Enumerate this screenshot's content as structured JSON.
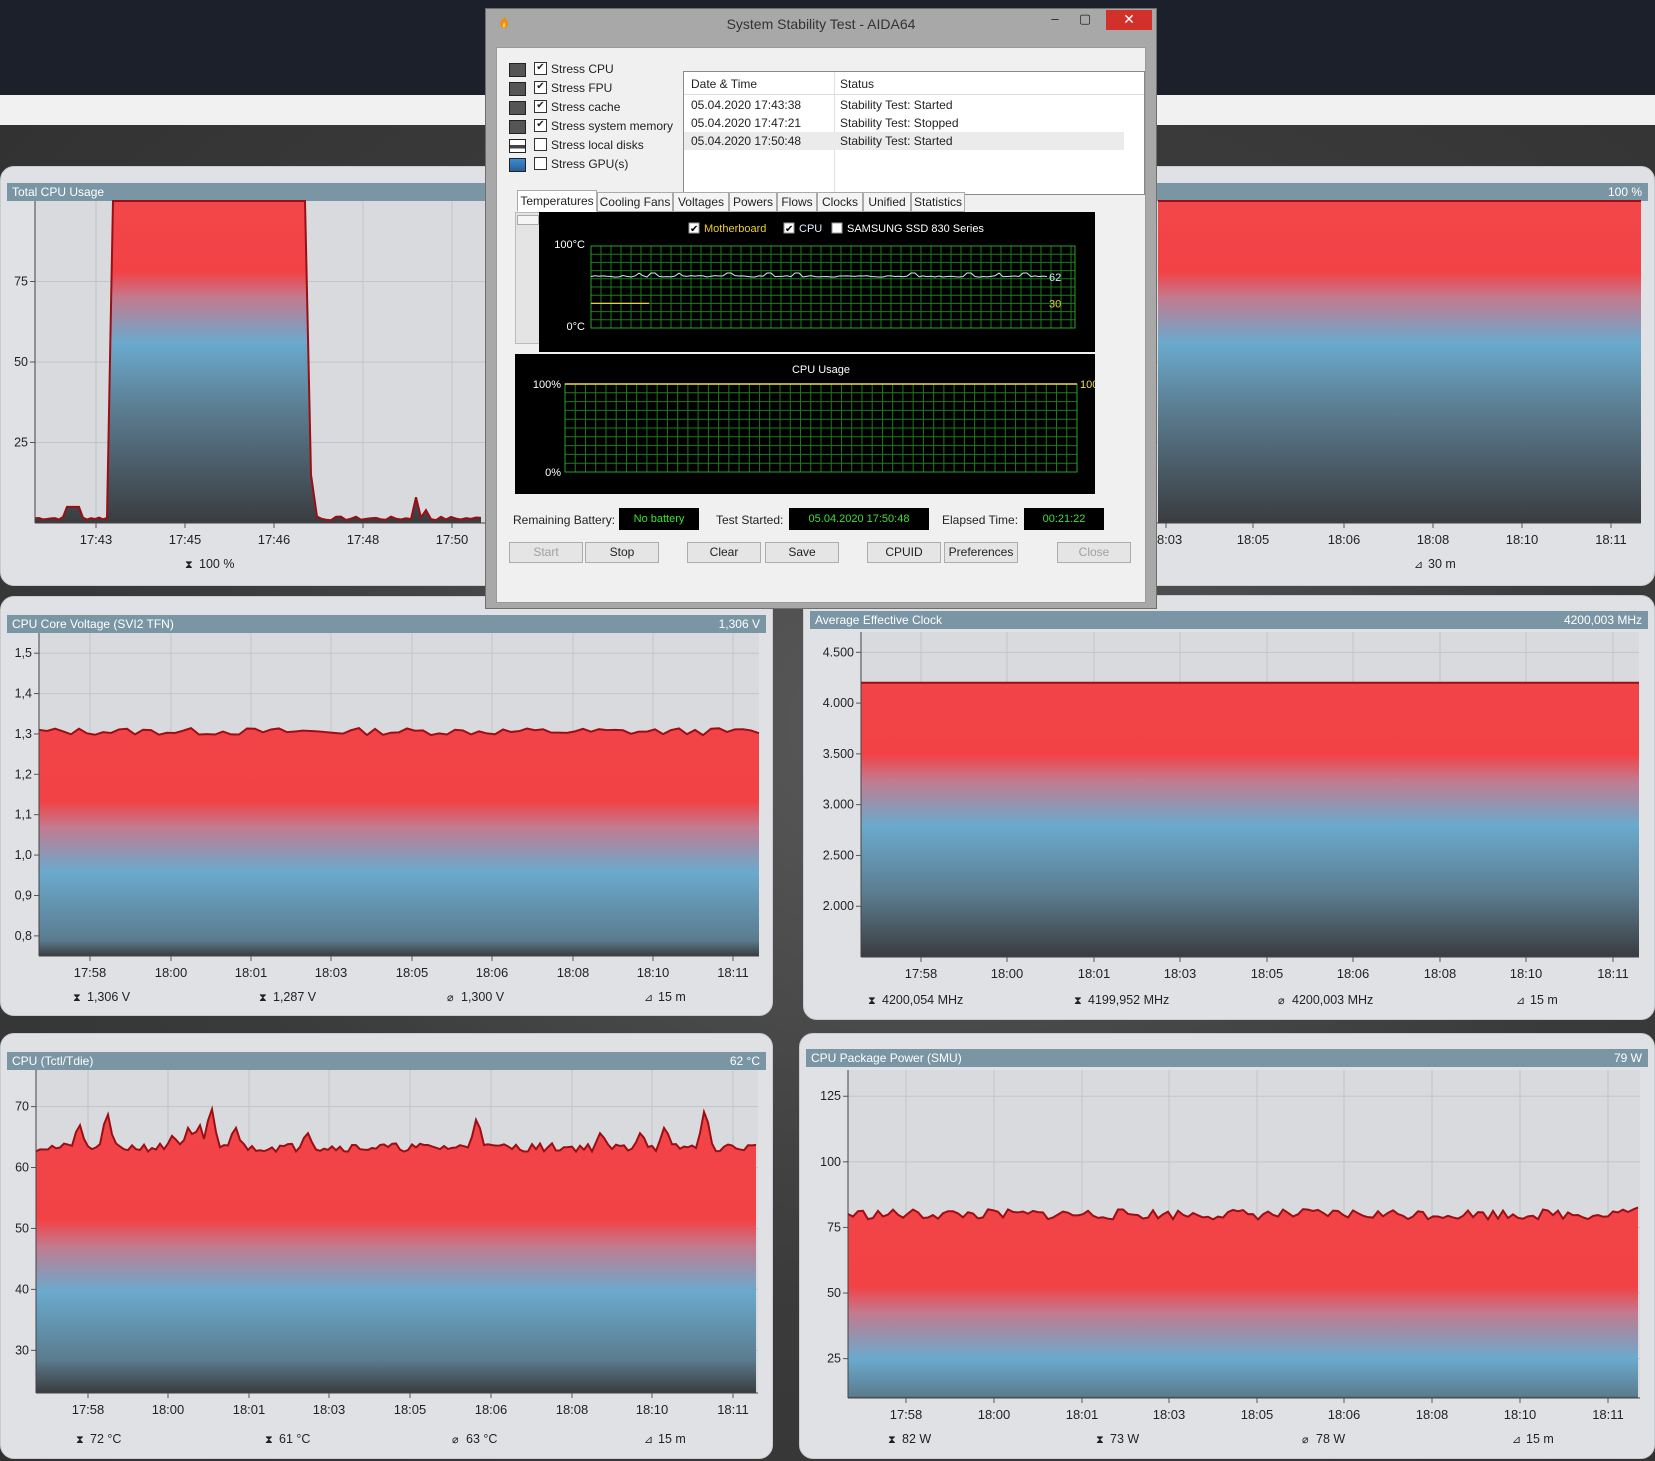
{
  "dialog": {
    "title": "System Stability Test - AIDA64",
    "stress_options": [
      {
        "label": "Stress CPU",
        "checked": true,
        "icon": "cpu-chip-icon"
      },
      {
        "label": "Stress FPU",
        "checked": true,
        "icon": "fpu-chip-icon"
      },
      {
        "label": "Stress cache",
        "checked": true,
        "icon": "cache-chip-icon"
      },
      {
        "label": "Stress system memory",
        "checked": true,
        "icon": "memory-module-icon"
      },
      {
        "label": "Stress local disks",
        "checked": false,
        "icon": "disk-drive-icon"
      },
      {
        "label": "Stress GPU(s)",
        "checked": false,
        "icon": "monitor-icon"
      }
    ],
    "log": {
      "headers": [
        "Date & Time",
        "Status"
      ],
      "rows": [
        [
          "05.04.2020 17:43:38",
          "Stability Test: Started"
        ],
        [
          "05.04.2020 17:47:21",
          "Stability Test: Stopped"
        ],
        [
          "05.04.2020 17:50:48",
          "Stability Test: Started"
        ]
      ]
    },
    "tabs": [
      "Temperatures",
      "Cooling Fans",
      "Voltages",
      "Powers",
      "Flows",
      "Clocks",
      "Unified",
      "Statistics"
    ],
    "temp_graph": {
      "legend": [
        {
          "label": "Motherboard",
          "checked": true,
          "color": "#f0d020"
        },
        {
          "label": "CPU",
          "checked": true,
          "color": "#e0f0ff"
        },
        {
          "label": "SAMSUNG SSD 830 Series",
          "checked": false,
          "color": "#ffffff"
        }
      ],
      "y_top": "100",
      "y_bottom": "0",
      "deg": "°C",
      "cpu_value": "62",
      "mb_value": "30"
    },
    "usage_graph": {
      "title": "CPU Usage",
      "y_top": "100%",
      "y_bottom": "0%",
      "value": "100%"
    },
    "remaining_battery_label": "Remaining Battery:",
    "remaining_battery_value": "No battery",
    "test_started_label": "Test Started:",
    "test_started_value": "05.04.2020 17:50:48",
    "elapsed_label": "Elapsed Time:",
    "elapsed_value": "00:21:22",
    "buttons": {
      "start": "Start",
      "stop": "Stop",
      "clear": "Clear",
      "save": "Save",
      "cpuid": "CPUID",
      "preferences": "Preferences",
      "close": "Close"
    }
  },
  "panels": {
    "total_cpu": {
      "title": "Total CPU Usage",
      "value": "100 %",
      "yticks": [
        "75",
        "50",
        "25"
      ],
      "xticks_left": [
        "17:43",
        "17:45",
        "17:46",
        "17:48",
        "17:50"
      ],
      "xticks_right": [
        "18:03",
        "18:05",
        "18:06",
        "18:08",
        "18:10",
        "18:11"
      ],
      "stat_max": "100 %",
      "stat_span": "30 m"
    },
    "voltage": {
      "title": "CPU Core Voltage (SVI2 TFN)",
      "value": "1,306 V",
      "yticks": [
        "1,5",
        "1,4",
        "1,3",
        "1,2",
        "1,1",
        "1,0",
        "0,9",
        "0,8"
      ],
      "xticks": [
        "17:58",
        "18:00",
        "18:01",
        "18:03",
        "18:05",
        "18:06",
        "18:08",
        "18:10",
        "18:11"
      ],
      "stat_max": "1,306 V",
      "stat_min": "1,287 V",
      "stat_avg": "1,300 V",
      "stat_span": "15 m"
    },
    "clock": {
      "title": "Average Effective Clock",
      "value": "4200,003 MHz",
      "yticks": [
        "4.500",
        "4.000",
        "3.500",
        "3.000",
        "2.500",
        "2.000"
      ],
      "xticks": [
        "17:58",
        "18:00",
        "18:01",
        "18:03",
        "18:05",
        "18:06",
        "18:08",
        "18:10",
        "18:11"
      ],
      "stat_max": "4200,054 MHz",
      "stat_min": "4199,952 MHz",
      "stat_avg": "4200,003 MHz",
      "stat_span": "15 m"
    },
    "temp": {
      "title": "CPU (Tctl/Tdie)",
      "value": "62 °C",
      "yticks": [
        "70",
        "60",
        "50",
        "40",
        "30"
      ],
      "xticks": [
        "17:58",
        "18:00",
        "18:01",
        "18:03",
        "18:05",
        "18:06",
        "18:08",
        "18:10",
        "18:11"
      ],
      "stat_max": "72 °C",
      "stat_min": "61 °C",
      "stat_avg": "63 °C",
      "stat_span": "15 m"
    },
    "power": {
      "title": "CPU Package Power (SMU)",
      "value": "79 W",
      "yticks": [
        "125",
        "100",
        "75",
        "50",
        "25"
      ],
      "xticks": [
        "17:58",
        "18:00",
        "18:01",
        "18:03",
        "18:05",
        "18:06",
        "18:08",
        "18:10",
        "18:11"
      ],
      "stat_max": "82 W",
      "stat_min": "73 W",
      "stat_avg": "78 W",
      "stat_span": "15 m"
    }
  },
  "colors": {
    "title_bar": "#7a95a3",
    "series_line": "#9a0f14",
    "fill_top": "#f24145",
    "fill_mid": "#6fa9c9",
    "fill_bottom": "#383b3e",
    "graph_green": "#1d7a1d"
  }
}
